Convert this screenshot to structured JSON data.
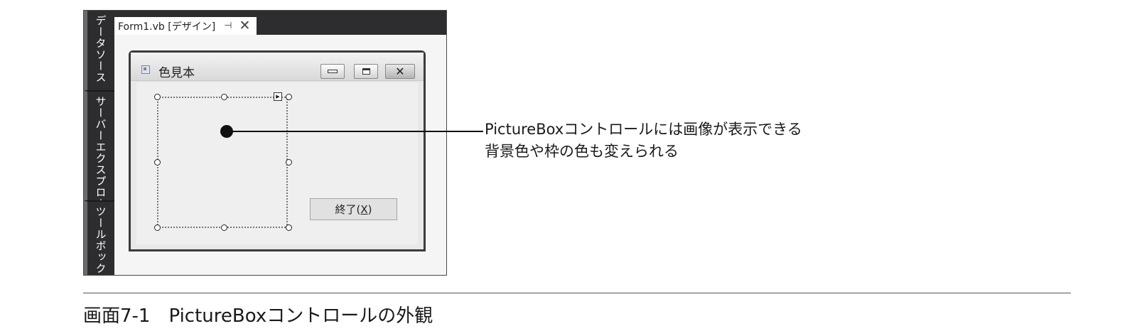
{
  "ide": {
    "side_tabs": [
      "データソース",
      "サーバーエクスプローラー",
      "ツールボックス"
    ],
    "doc_tab": {
      "label": "Form1.vb [デザイン]",
      "pin_icon": "pin-icon",
      "close_icon": "close-icon"
    }
  },
  "form": {
    "title": "色見本",
    "icon": "form-icon",
    "controls": {
      "minimize_icon": "minimize-icon",
      "maximize_icon": "maximize-icon",
      "close_icon": "close-icon"
    },
    "picture_box": {
      "selected": true
    },
    "exit_button": {
      "label_pre": "終了(",
      "mnemonic": "X",
      "label_post": ")"
    }
  },
  "callout": {
    "line1": "PictureBoxコントロールには画像が表示できる",
    "line2": "背景色や枠の色も変えられる"
  },
  "caption": "画面7-1　PictureBoxコントロールの外観"
}
